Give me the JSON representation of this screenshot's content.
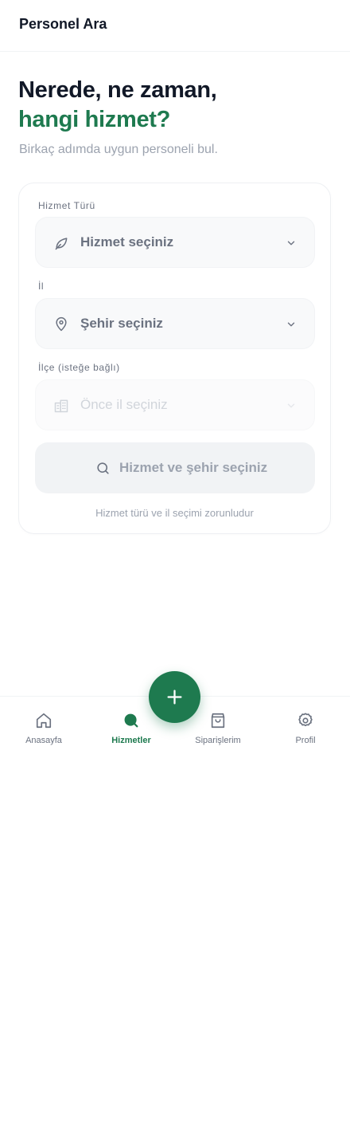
{
  "header": {
    "title": "Personel Ara"
  },
  "hero": {
    "line1": "Nerede, ne zaman,",
    "line2": "hangi hizmet?",
    "subtitle": "Birkaç adımda uygun personeli bul."
  },
  "form": {
    "service": {
      "label": "Hizmet Türü",
      "placeholder": "Hizmet seçiniz",
      "icon": "leaf-icon"
    },
    "city": {
      "label": "İl",
      "placeholder": "Şehir seçiniz",
      "icon": "map-pin-icon"
    },
    "district": {
      "label": "İlçe (isteğe bağlı)",
      "placeholder": "Önce il seçiniz",
      "icon": "building-icon",
      "disabled": true
    },
    "submit_label": "Hizmet ve şehir seçiniz",
    "helper": "Hizmet türü ve il seçimi zorunludur"
  },
  "nav": {
    "items": [
      {
        "label": "Anasayfa",
        "icon": "home-icon"
      },
      {
        "label": "Hizmetler",
        "icon": "search-icon",
        "active": true
      },
      {
        "label": "Siparişlerim",
        "icon": "shopping-bag-icon"
      },
      {
        "label": "Profil",
        "icon": "gear-icon"
      }
    ],
    "fab_icon": "plus-icon"
  },
  "colors": {
    "accent": "#1e7a4f",
    "text_primary": "#111827",
    "text_muted": "#9ca3af",
    "field_bg": "#f8f9fa"
  }
}
